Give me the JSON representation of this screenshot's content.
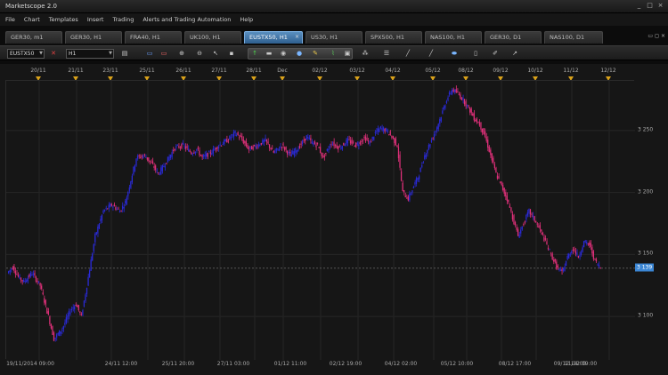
{
  "app": {
    "title": "Marketscope 2.0"
  },
  "window_controls": [
    "_",
    "□",
    "×"
  ],
  "menu": [
    "File",
    "Chart",
    "Templates",
    "Insert",
    "Trading",
    "Alerts and Trading Automation",
    "Help"
  ],
  "tabs": [
    {
      "label": "GER30, m1",
      "active": false
    },
    {
      "label": "GER30, H1",
      "active": false
    },
    {
      "label": "FRA40, H1",
      "active": false
    },
    {
      "label": "UK100, H1",
      "active": false
    },
    {
      "label": "EUSTX50, H1",
      "active": true
    },
    {
      "label": "US30, H1",
      "active": false
    },
    {
      "label": "SPX500, H1",
      "active": false
    },
    {
      "label": "NAS100, H1",
      "active": false
    },
    {
      "label": "GER30, D1",
      "active": false
    },
    {
      "label": "NAS100, D1",
      "active": false
    }
  ],
  "toolbar": {
    "instrument": "EUSTX50",
    "timeframe": "H1"
  },
  "chart": {
    "top_dates": [
      "20/11",
      "21/11",
      "23/11",
      "25/11",
      "26/11",
      "27/11",
      "28/11",
      "Dec",
      "02/12",
      "03/12",
      "04/12",
      "05/12",
      "08/12",
      "09/12",
      "10/12",
      "11/12",
      "12/12"
    ],
    "bottom_dates": [
      "19/11/2014 09:00",
      "24/11 12:00",
      "25/11 20:00",
      "27/11 03:00",
      "01/12 11:00",
      "02/12 19:00",
      "04/12 02:00",
      "05/12 10:00",
      "08/12 17:00",
      "09/12 14:00",
      "11/12 09:00"
    ],
    "y_ticks": [
      "3 250",
      "3 200",
      "3 150",
      "3 100"
    ],
    "current_price": "3 139",
    "colors": {
      "up": "#2a2ad8",
      "down": "#e0307a",
      "background": "#161616",
      "grid": "#262626",
      "marker": "#d9a21b"
    }
  },
  "chart_data": {
    "type": "candlestick",
    "ylim": [
      3065,
      3290
    ],
    "y_ticks": [
      3250,
      3200,
      3150,
      3100
    ],
    "current_price": 3139,
    "keypoints": [
      [
        0,
        3135
      ],
      [
        4,
        3140
      ],
      [
        8,
        3132
      ],
      [
        12,
        3128
      ],
      [
        18,
        3135
      ],
      [
        24,
        3125
      ],
      [
        30,
        3100
      ],
      [
        34,
        3082
      ],
      [
        40,
        3090
      ],
      [
        46,
        3105
      ],
      [
        50,
        3110
      ],
      [
        54,
        3100
      ],
      [
        58,
        3125
      ],
      [
        64,
        3165
      ],
      [
        70,
        3185
      ],
      [
        76,
        3190
      ],
      [
        82,
        3185
      ],
      [
        86,
        3192
      ],
      [
        90,
        3210
      ],
      [
        94,
        3228
      ],
      [
        100,
        3230
      ],
      [
        106,
        3222
      ],
      [
        110,
        3215
      ],
      [
        116,
        3225
      ],
      [
        122,
        3236
      ],
      [
        128,
        3238
      ],
      [
        134,
        3232
      ],
      [
        138,
        3235
      ],
      [
        142,
        3228
      ],
      [
        148,
        3232
      ],
      [
        154,
        3238
      ],
      [
        160,
        3242
      ],
      [
        166,
        3248
      ],
      [
        170,
        3244
      ],
      [
        176,
        3235
      ],
      [
        182,
        3238
      ],
      [
        188,
        3242
      ],
      [
        194,
        3232
      ],
      [
        200,
        3238
      ],
      [
        206,
        3230
      ],
      [
        212,
        3236
      ],
      [
        218,
        3245
      ],
      [
        222,
        3240
      ],
      [
        226,
        3238
      ],
      [
        230,
        3228
      ],
      [
        236,
        3240
      ],
      [
        242,
        3236
      ],
      [
        248,
        3242
      ],
      [
        254,
        3238
      ],
      [
        260,
        3244
      ],
      [
        264,
        3240
      ],
      [
        268,
        3248
      ],
      [
        272,
        3252
      ],
      [
        276,
        3250
      ],
      [
        280,
        3245
      ],
      [
        284,
        3238
      ],
      [
        288,
        3200
      ],
      [
        292,
        3195
      ],
      [
        296,
        3205
      ],
      [
        300,
        3215
      ],
      [
        304,
        3230
      ],
      [
        308,
        3240
      ],
      [
        312,
        3250
      ],
      [
        316,
        3262
      ],
      [
        320,
        3275
      ],
      [
        324,
        3283
      ],
      [
        328,
        3280
      ],
      [
        332,
        3275
      ],
      [
        336,
        3268
      ],
      [
        340,
        3260
      ],
      [
        344,
        3255
      ],
      [
        348,
        3245
      ],
      [
        352,
        3230
      ],
      [
        356,
        3215
      ],
      [
        360,
        3205
      ],
      [
        364,
        3195
      ],
      [
        368,
        3180
      ],
      [
        372,
        3165
      ],
      [
        376,
        3175
      ],
      [
        380,
        3185
      ],
      [
        384,
        3178
      ],
      [
        388,
        3170
      ],
      [
        392,
        3160
      ],
      [
        396,
        3150
      ],
      [
        400,
        3140
      ],
      [
        404,
        3135
      ],
      [
        408,
        3148
      ],
      [
        412,
        3155
      ],
      [
        416,
        3148
      ],
      [
        420,
        3160
      ],
      [
        424,
        3158
      ],
      [
        428,
        3145
      ],
      [
        432,
        3139
      ]
    ],
    "xlabel": "",
    "ylabel": ""
  }
}
